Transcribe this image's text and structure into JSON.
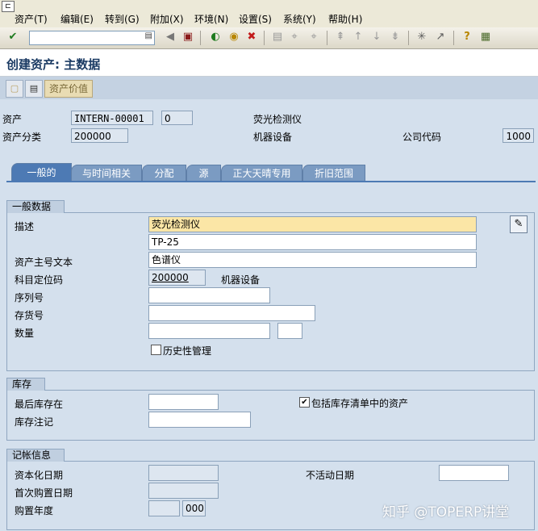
{
  "menu": {
    "items": [
      "资产(T)",
      "编辑(E)",
      "转到(G)",
      "附加(X)",
      "环境(N)",
      "设置(S)",
      "系统(Y)",
      "帮助(H)"
    ]
  },
  "toolbar": {
    "command_field_value": "",
    "icons": [
      "check-icon",
      "command-field",
      "back-arrow-icon",
      "save-icon",
      "back-icon",
      "exit-icon",
      "cancel-icon",
      "print-icon",
      "find-icon",
      "find-next-icon",
      "first-page-icon",
      "previous-page-icon",
      "next-page-icon",
      "last-page-icon",
      "create-session-icon",
      "shortcut-icon",
      "help-icon",
      "layout-menu-icon"
    ]
  },
  "title": "创建资产: 主数据",
  "app_toolbar": {
    "asset_value_label": "资产价值"
  },
  "header": {
    "asset_label": "资产",
    "asset_number": "INTERN-00001",
    "asset_subnumber": "0",
    "asset_description": "荧光检测仪",
    "asset_class_label": "资产分类",
    "asset_class": "200000",
    "asset_class_text": "机器设备",
    "company_code_label": "公司代码",
    "company_code": "1000"
  },
  "tabs": [
    {
      "label": "一般的",
      "active": true
    },
    {
      "label": "与时间相关",
      "active": false
    },
    {
      "label": "分配",
      "active": false
    },
    {
      "label": "源",
      "active": false
    },
    {
      "label": "正大天晴专用",
      "active": false
    },
    {
      "label": "折旧范围",
      "active": false
    }
  ],
  "general_data": {
    "title": "一般数据",
    "description_label": "描述",
    "description_1": "荧光检测仪",
    "description_2": "TP-25",
    "main_number_text_label": "资产主号文本",
    "main_number_text": "色谱仪",
    "account_determination_label": "科目定位码",
    "account_determination": "200000",
    "account_determination_text": "机器设备",
    "serial_number_label": "序列号",
    "serial_number": "",
    "inventory_number_label": "存货号",
    "inventory_number": "",
    "quantity_label": "数量",
    "quantity": "",
    "unit": "",
    "history_mgmt_label": "历史性管理",
    "history_mgmt_checked": false
  },
  "inventory": {
    "title": "库存",
    "last_inventory_label": "最后库存在",
    "last_inventory": "",
    "inventory_note_label": "库存注记",
    "inventory_note": "",
    "include_in_list_label": "包括库存清单中的资产",
    "include_in_list_checked": true
  },
  "posting_info": {
    "title": "记帐信息",
    "capitalization_date_label": "资本化日期",
    "capitalization_date": "",
    "first_acquisition_label": "首次购置日期",
    "first_acquisition": "",
    "acquisition_year_label": "购置年度",
    "acquisition_year": "",
    "acquisition_period": "000",
    "deactivation_date_label": "不活动日期",
    "deactivation_date": ""
  },
  "watermark": "知乎 @TOPERP讲堂"
}
